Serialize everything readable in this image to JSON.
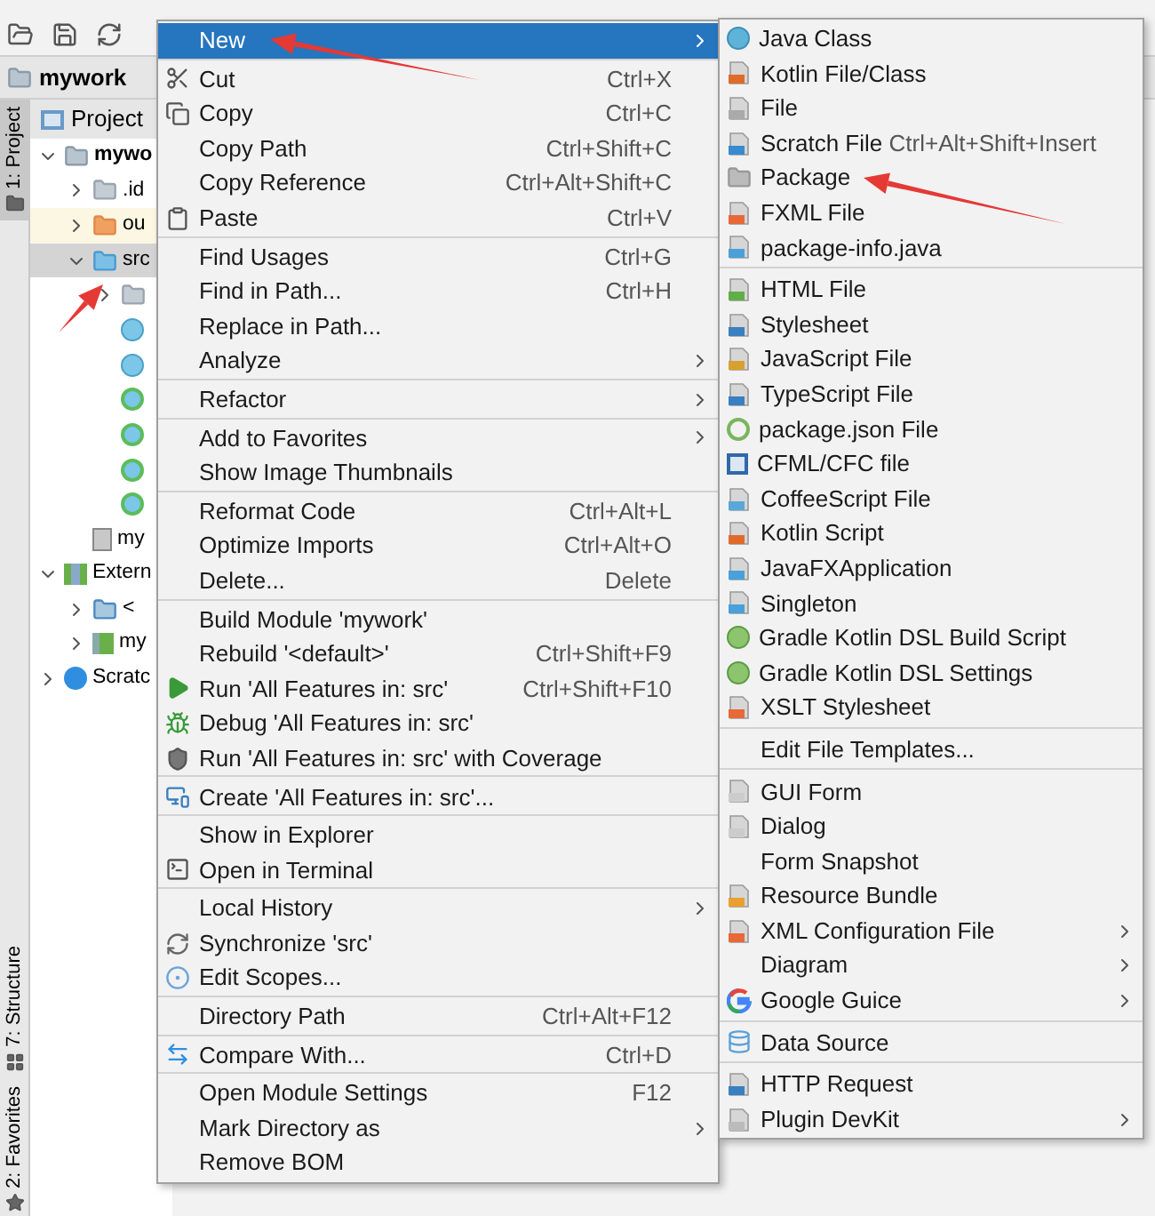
{
  "toolbar": {
    "buttons": [
      {
        "kind": "open"
      },
      {
        "kind": "save"
      },
      {
        "kind": "sync"
      }
    ]
  },
  "breadcrumb": {
    "label": "mywork"
  },
  "side_tabs": [
    {
      "label": "1: Project",
      "selected": true,
      "kind": "project"
    },
    {
      "label": "7: Structure",
      "selected": false,
      "kind": "structure"
    },
    {
      "label": "2: Favorites",
      "selected": false,
      "kind": "favorites"
    }
  ],
  "project_panel": {
    "title": "Project",
    "tree": [
      {
        "label": "mywo",
        "kind": "module",
        "expanded": true,
        "selected": false,
        "children": [
          {
            "label": ".id",
            "kind": "folder",
            "expanded": false,
            "selected": false
          },
          {
            "label": "ou",
            "kind": "excluded",
            "expanded": false,
            "selected": false
          },
          {
            "label": "src",
            "kind": "source",
            "expanded": true,
            "selected": true,
            "children": [
              {
                "kind": "folder",
                "expanded": false,
                "selected": false
              },
              {
                "kind": "class",
                "selected": false
              },
              {
                "kind": "class",
                "selected": false
              },
              {
                "kind": "runnable",
                "selected": false
              },
              {
                "kind": "runnable",
                "selected": false
              },
              {
                "kind": "runnable",
                "selected": false
              },
              {
                "kind": "runnable",
                "selected": false
              }
            ]
          },
          {
            "label": "my",
            "kind": "iml",
            "selected": false
          }
        ]
      },
      {
        "label": "Extern",
        "kind": "libraries",
        "expanded": true,
        "selected": false,
        "children": [
          {
            "label": "<",
            "kind": "jdk",
            "expanded": false,
            "selected": false
          },
          {
            "label": "my",
            "kind": "library",
            "expanded": false,
            "selected": false
          }
        ]
      },
      {
        "label": "Scratc",
        "kind": "scratches",
        "expanded": false,
        "selected": false
      }
    ]
  },
  "context_menu": {
    "groups": [
      [
        {
          "label": "New",
          "selected": true,
          "submenu": true
        }
      ],
      [
        {
          "label": "Cut",
          "shortcut": "Ctrl+X",
          "kind": "cut",
          "selected": false
        },
        {
          "label": "Copy",
          "shortcut": "Ctrl+C",
          "kind": "copy",
          "selected": false
        },
        {
          "label": "Copy Path",
          "shortcut": "Ctrl+Shift+C",
          "selected": false
        },
        {
          "label": "Copy Reference",
          "shortcut": "Ctrl+Alt+Shift+C",
          "selected": false
        },
        {
          "label": "Paste",
          "shortcut": "Ctrl+V",
          "kind": "paste",
          "selected": false
        }
      ],
      [
        {
          "label": "Find Usages",
          "shortcut": "Ctrl+G",
          "selected": false
        },
        {
          "label": "Find in Path...",
          "shortcut": "Ctrl+H",
          "selected": false
        },
        {
          "label": "Replace in Path...",
          "selected": false
        },
        {
          "label": "Analyze",
          "submenu": true,
          "selected": false
        }
      ],
      [
        {
          "label": "Refactor",
          "submenu": true,
          "selected": false
        }
      ],
      [
        {
          "label": "Add to Favorites",
          "submenu": true,
          "selected": false
        },
        {
          "label": "Show Image Thumbnails",
          "selected": false
        }
      ],
      [
        {
          "label": "Reformat Code",
          "shortcut": "Ctrl+Alt+L",
          "selected": false
        },
        {
          "label": "Optimize Imports",
          "shortcut": "Ctrl+Alt+O",
          "selected": false
        },
        {
          "label": "Delete...",
          "shortcut": "Delete",
          "selected": false
        }
      ],
      [
        {
          "label": "Build Module 'mywork'",
          "selected": false
        },
        {
          "label": "Rebuild '<default>'",
          "shortcut": "Ctrl+Shift+F9",
          "selected": false
        },
        {
          "label": "Run 'All Features in: src'",
          "shortcut": "Ctrl+Shift+F10",
          "kind": "run",
          "selected": false
        },
        {
          "label": "Debug 'All Features in: src'",
          "kind": "debug",
          "selected": false
        },
        {
          "label": "Run 'All Features in: src' with Coverage",
          "kind": "coverage",
          "selected": false
        }
      ],
      [
        {
          "label": "Create 'All Features in: src'...",
          "kind": "create",
          "selected": false
        }
      ],
      [
        {
          "label": "Show in Explorer",
          "selected": false
        },
        {
          "label": "Open in Terminal",
          "kind": "terminal",
          "selected": false
        }
      ],
      [
        {
          "label": "Local History",
          "submenu": true,
          "selected": false
        },
        {
          "label": "Synchronize 'src'",
          "kind": "sync",
          "selected": false
        },
        {
          "label": "Edit Scopes...",
          "kind": "scopes",
          "selected": false
        }
      ],
      [
        {
          "label": "Directory Path",
          "shortcut": "Ctrl+Alt+F12",
          "selected": false
        }
      ],
      [
        {
          "label": "Compare With...",
          "shortcut": "Ctrl+D",
          "kind": "compare",
          "selected": false
        }
      ],
      [
        {
          "label": "Open Module Settings",
          "shortcut": "F12",
          "selected": false
        },
        {
          "label": "Mark Directory as",
          "submenu": true,
          "selected": false
        },
        {
          "label": "Remove BOM",
          "selected": false
        }
      ]
    ]
  },
  "new_submenu": {
    "groups": [
      [
        {
          "label": "Java Class",
          "kind": "java-class"
        },
        {
          "label": "Kotlin File/Class",
          "kind": "kotlin"
        },
        {
          "label": "File",
          "kind": "file"
        },
        {
          "label": "Scratch File",
          "shortcut": "Ctrl+Alt+Shift+Insert",
          "kind": "scratch"
        },
        {
          "label": "Package",
          "kind": "package"
        },
        {
          "label": "FXML File",
          "kind": "fxml"
        },
        {
          "label": "package-info.java",
          "kind": "java-file"
        }
      ],
      [
        {
          "label": "HTML File",
          "kind": "html"
        },
        {
          "label": "Stylesheet",
          "kind": "css"
        },
        {
          "label": "JavaScript File",
          "kind": "js"
        },
        {
          "label": "TypeScript File",
          "kind": "ts"
        },
        {
          "label": "package.json File",
          "kind": "nodejs"
        },
        {
          "label": "CFML/CFC file",
          "kind": "cfml"
        },
        {
          "label": "CoffeeScript File",
          "kind": "coffee"
        },
        {
          "label": "Kotlin Script",
          "kind": "kotlin"
        },
        {
          "label": "JavaFXApplication",
          "kind": "java-file"
        },
        {
          "label": "Singleton",
          "kind": "java-file"
        },
        {
          "label": "Gradle Kotlin DSL Build Script",
          "kind": "gradle"
        },
        {
          "label": "Gradle Kotlin DSL Settings",
          "kind": "gradle"
        },
        {
          "label": "XSLT Stylesheet",
          "kind": "fxml"
        }
      ],
      [
        {
          "label": "Edit File Templates..."
        }
      ],
      [
        {
          "label": "GUI Form",
          "kind": "form"
        },
        {
          "label": "Dialog",
          "kind": "form"
        },
        {
          "label": "Form Snapshot"
        },
        {
          "label": "Resource Bundle",
          "kind": "resource"
        },
        {
          "label": "XML Configuration File",
          "kind": "fxml",
          "submenu": true
        },
        {
          "label": "Diagram",
          "submenu": true
        },
        {
          "label": "Google Guice",
          "kind": "google",
          "submenu": true
        }
      ],
      [
        {
          "label": "Data Source",
          "kind": "database"
        }
      ],
      [
        {
          "label": "HTTP Request",
          "kind": "api"
        },
        {
          "label": "Plugin DevKit",
          "kind": "plugin",
          "submenu": true
        }
      ]
    ]
  },
  "annotations": [
    {
      "kind": "arrow"
    },
    {
      "kind": "arrow"
    },
    {
      "kind": "arrow"
    }
  ]
}
